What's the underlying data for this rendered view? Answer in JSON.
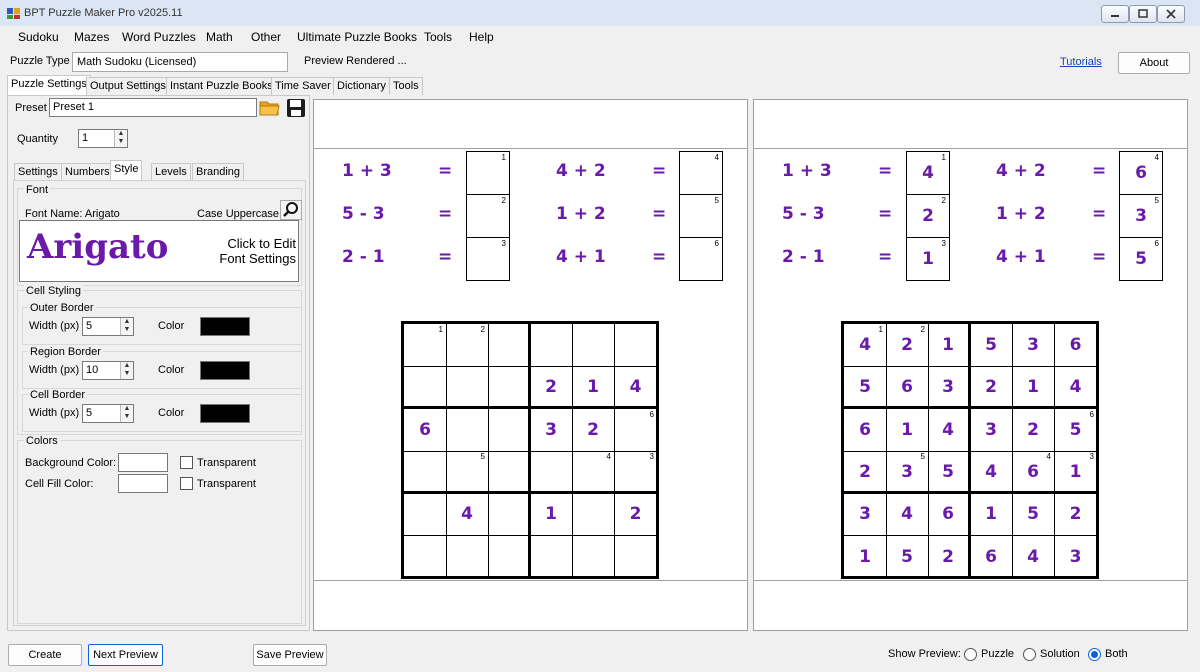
{
  "window": {
    "title": "BPT Puzzle Maker Pro v2025.11"
  },
  "menu": [
    "Sudoku",
    "Mazes",
    "Word Puzzles",
    "Math",
    "Other",
    "Ultimate Puzzle Books",
    "Tools",
    "Help"
  ],
  "toolbar": {
    "puzzle_type_label": "Puzzle Type",
    "puzzle_type_value": "Math Sudoku (Licensed)",
    "preview_status": "Preview Rendered ...",
    "tutorials": "Tutorials",
    "about": "About"
  },
  "main_tabs": [
    "Puzzle Settings",
    "Output Settings",
    "Instant Puzzle Books",
    "Time Saver",
    "Dictionary",
    "Tools"
  ],
  "settings": {
    "preset_label": "Preset",
    "preset_value": "Preset 1",
    "quantity_label": "Quantity",
    "quantity_value": "1",
    "sub_tabs": [
      "Settings",
      "Numbers",
      "Style",
      "Levels",
      "Branding"
    ],
    "font_group": "Font",
    "font_name": "Font Name: Arigato",
    "case": "Case Uppercase",
    "font_sample": "Arigato",
    "font_edit_line1": "Click to Edit",
    "font_edit_line2": "Font Settings",
    "cell_styling": "Cell Styling",
    "outer_border": "Outer Border",
    "region_border": "Region Border",
    "cell_border": "Cell Border",
    "width_label": "Width (px)",
    "color_label": "Color",
    "outer_width": "5",
    "region_width": "10",
    "cell_width": "5",
    "colors_group": "Colors",
    "bg_color_label": "Background Color:",
    "fill_color_label": "Cell Fill Color:",
    "transparent_label": "Transparent"
  },
  "colors": {
    "accent": "#6a1aa8",
    "border_color": "#000000"
  },
  "clues": [
    {
      "expr_a": "1 + 3",
      "num_a": "1",
      "ans_a": "4",
      "expr_b": "4 + 2",
      "num_b": "4",
      "ans_b": "6"
    },
    {
      "expr_a": "5 - 3",
      "num_a": "2",
      "ans_a": "2",
      "expr_b": "1 + 2",
      "num_b": "5",
      "ans_b": "3"
    },
    {
      "expr_a": "2 - 1",
      "num_a": "3",
      "ans_a": "1",
      "expr_b": "4 + 1",
      "num_b": "6",
      "ans_b": "5"
    }
  ],
  "equals": "=",
  "puzzle_grid": [
    [
      "",
      "",
      "",
      "",
      "",
      ""
    ],
    [
      "",
      "",
      "",
      "2",
      "1",
      "4"
    ],
    [
      "6",
      "",
      "",
      "3",
      "2",
      ""
    ],
    [
      "",
      "",
      "",
      "",
      "",
      ""
    ],
    [
      "",
      "4",
      "",
      "1",
      "",
      "2"
    ],
    [
      "",
      "",
      "",
      "",
      "",
      ""
    ]
  ],
  "solution_grid": [
    [
      "4",
      "2",
      "1",
      "5",
      "3",
      "6"
    ],
    [
      "5",
      "6",
      "3",
      "2",
      "1",
      "4"
    ],
    [
      "6",
      "1",
      "4",
      "3",
      "2",
      "5"
    ],
    [
      "2",
      "3",
      "5",
      "4",
      "6",
      "1"
    ],
    [
      "3",
      "4",
      "6",
      "1",
      "5",
      "2"
    ],
    [
      "1",
      "5",
      "2",
      "6",
      "4",
      "3"
    ]
  ],
  "clue_marks": [
    {
      "row": 0,
      "col": 0,
      "n": "1"
    },
    {
      "row": 0,
      "col": 1,
      "n": "2"
    },
    {
      "row": 2,
      "col": 5,
      "n": "6"
    },
    {
      "row": 3,
      "col": 1,
      "n": "5"
    },
    {
      "row": 3,
      "col": 4,
      "n": "4"
    },
    {
      "row": 3,
      "col": 5,
      "n": "3"
    }
  ],
  "bottom": {
    "create": "Create",
    "next_preview": "Next Preview",
    "save_preview": "Save Preview",
    "show_preview": "Show Preview:",
    "opt_puzzle": "Puzzle",
    "opt_solution": "Solution",
    "opt_both": "Both",
    "selected": "Both"
  }
}
